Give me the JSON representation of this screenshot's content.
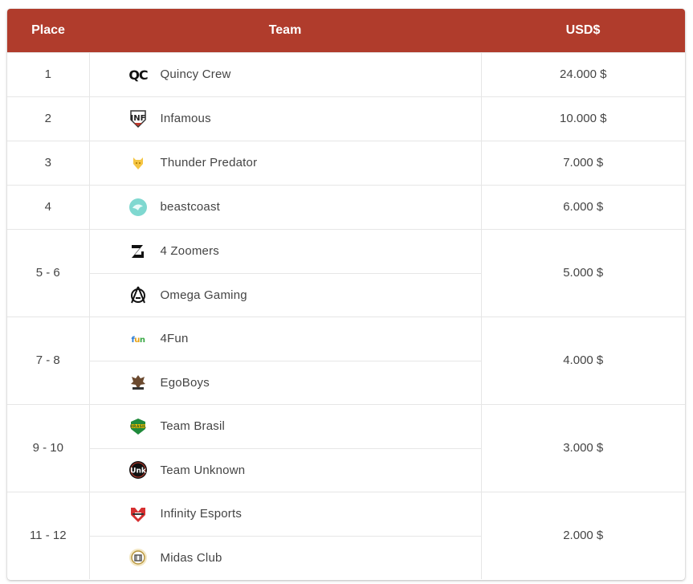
{
  "header": {
    "place": "Place",
    "team": "Team",
    "usd": "USD$"
  },
  "groups": [
    {
      "place": "1",
      "prize": "24.000 $",
      "teams": [
        {
          "name": "Quincy Crew",
          "icon": "quincy-crew-logo-icon"
        }
      ]
    },
    {
      "place": "2",
      "prize": "10.000 $",
      "teams": [
        {
          "name": "Infamous",
          "icon": "infamous-logo-icon"
        }
      ]
    },
    {
      "place": "3",
      "prize": "7.000 $",
      "teams": [
        {
          "name": "Thunder Predator",
          "icon": "thunder-predator-logo-icon"
        }
      ]
    },
    {
      "place": "4",
      "prize": "6.000 $",
      "teams": [
        {
          "name": "beastcoast",
          "icon": "beastcoast-logo-icon"
        }
      ]
    },
    {
      "place": "5 - 6",
      "prize": "5.000 $",
      "teams": [
        {
          "name": "4 Zoomers",
          "icon": "4-zoomers-logo-icon"
        },
        {
          "name": "Omega Gaming",
          "icon": "omega-gaming-logo-icon"
        }
      ]
    },
    {
      "place": "7 - 8",
      "prize": "4.000 $",
      "teams": [
        {
          "name": "4Fun",
          "icon": "4fun-logo-icon"
        },
        {
          "name": "EgoBoys",
          "icon": "egoboys-logo-icon"
        }
      ]
    },
    {
      "place": "9 - 10",
      "prize": "3.000 $",
      "teams": [
        {
          "name": "Team Brasil",
          "icon": "team-brasil-logo-icon"
        },
        {
          "name": "Team Unknown",
          "icon": "team-unknown-logo-icon"
        }
      ]
    },
    {
      "place": "11 - 12",
      "prize": "2.000 $",
      "teams": [
        {
          "name": "Infinity Esports",
          "icon": "infinity-esports-logo-icon"
        },
        {
          "name": "Midas Club",
          "icon": "midas-club-logo-icon"
        }
      ]
    }
  ],
  "colors": {
    "header_bg": "#b03c2c",
    "header_text": "#ffffff",
    "row_border": "#e6e6e6",
    "text": "#444444"
  }
}
